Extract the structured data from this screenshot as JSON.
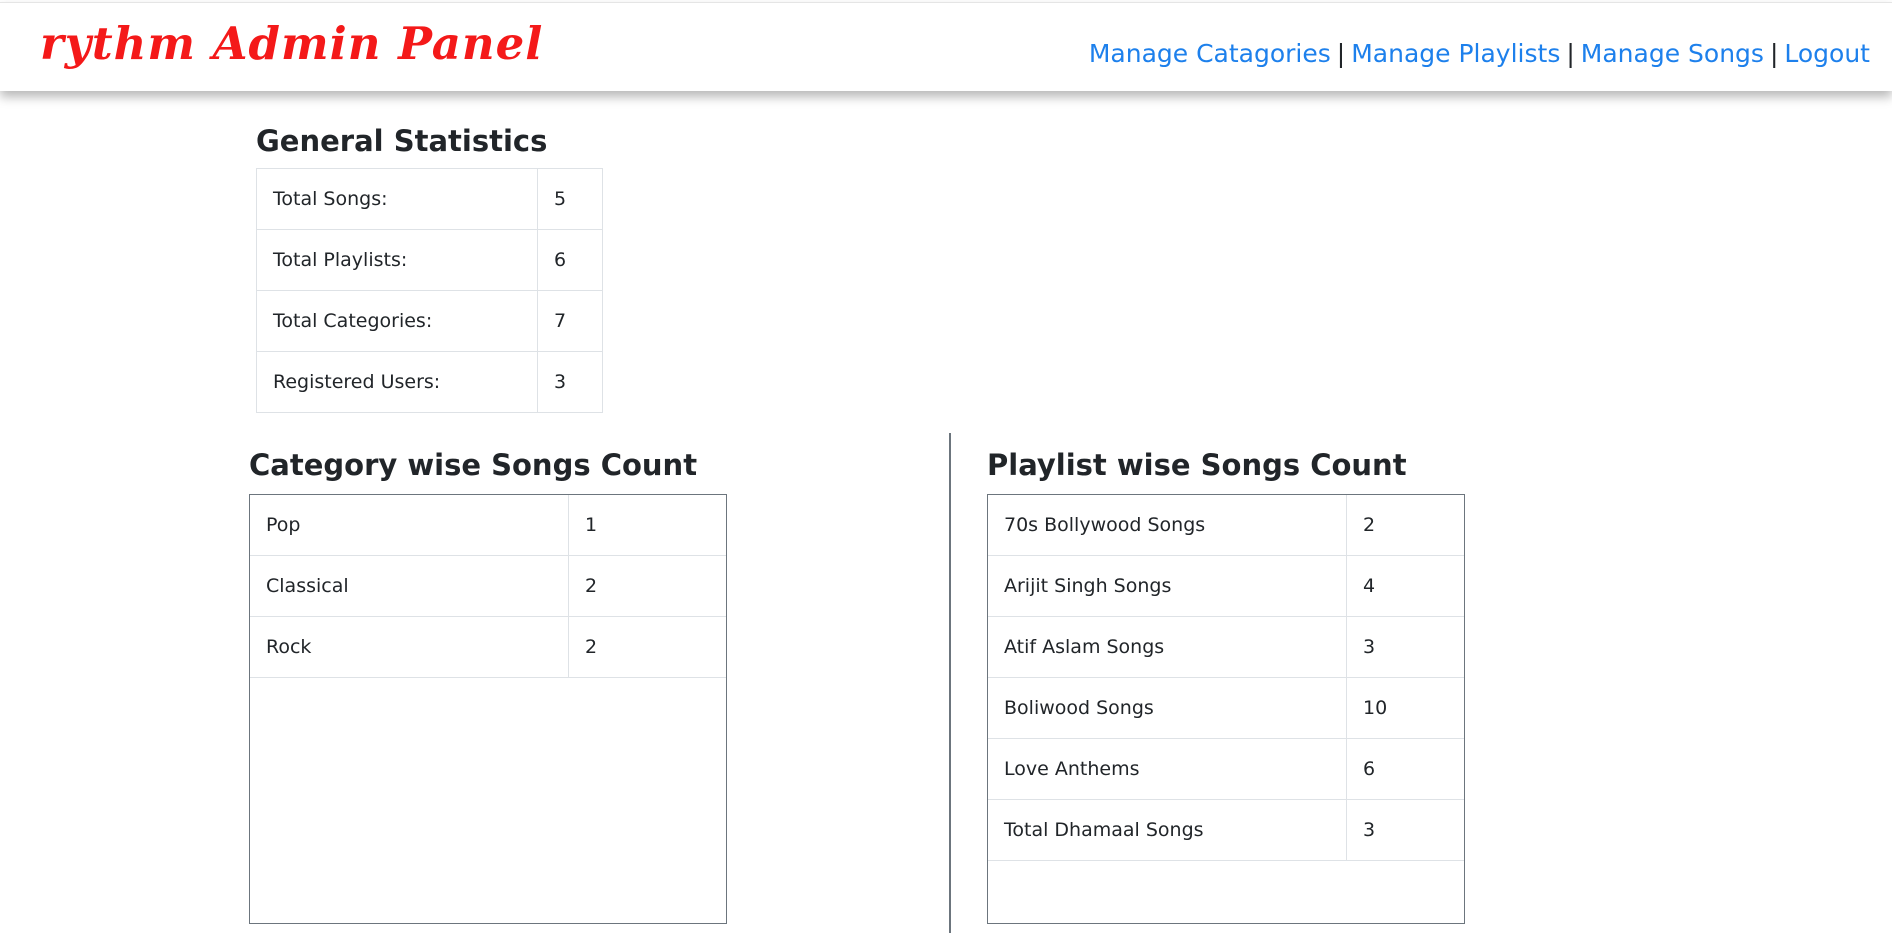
{
  "header": {
    "brand": "rythm Admin Panel",
    "links": [
      "Manage Catagories",
      "Manage Playlists",
      "Manage Songs",
      "Logout"
    ],
    "separator": "|",
    "brand_color": "#f41919",
    "link_color": "#1d80ec"
  },
  "general_stats": {
    "title": "General Statistics",
    "rows": [
      {
        "label": "Total Songs:",
        "value": "5"
      },
      {
        "label": "Total Playlists:",
        "value": "6"
      },
      {
        "label": "Total Categories:",
        "value": "7"
      },
      {
        "label": "Registered Users:",
        "value": "3"
      }
    ]
  },
  "category_counts": {
    "title": "Category wise Songs Count",
    "rows": [
      {
        "name": "Pop",
        "count": "1"
      },
      {
        "name": "Classical",
        "count": "2"
      },
      {
        "name": "Rock",
        "count": "2"
      }
    ]
  },
  "playlist_counts": {
    "title": "Playlist wise Songs Count",
    "rows": [
      {
        "name": "70s Bollywood Songs",
        "count": "2"
      },
      {
        "name": "Arijit Singh Songs",
        "count": "4"
      },
      {
        "name": "Atif Aslam Songs",
        "count": "3"
      },
      {
        "name": "Boliwood Songs",
        "count": "10"
      },
      {
        "name": "Love Anthems",
        "count": "6"
      },
      {
        "name": "Total Dhamaal Songs",
        "count": "3"
      }
    ]
  }
}
